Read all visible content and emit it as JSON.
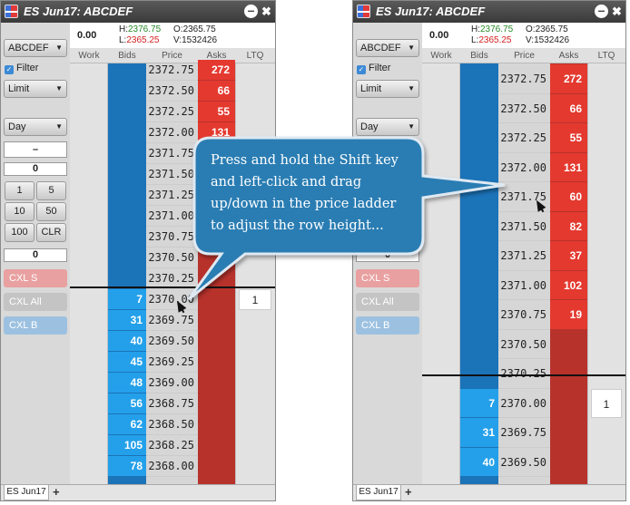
{
  "window_title": "ES Jun17: ABCDEF",
  "minimize_glyph": "–",
  "close_glyph": "✖",
  "quote": {
    "last": "0.00",
    "high_label": "H:",
    "high": "2376.75",
    "low_label": "L:",
    "low": "2365.25",
    "open_label": "O:",
    "open": "2365.75",
    "volume_label": "V:",
    "volume": "1532426"
  },
  "panel": {
    "account": "ABCDEF",
    "filter_label": "Filter",
    "order_type": "Limit",
    "tif": "Day",
    "field_dash": "–",
    "qty_value": "0",
    "qty_buttons": [
      "1",
      "5",
      "10",
      "50",
      "100",
      "CLR"
    ],
    "qty_total": "0",
    "cxl_s": "CXL S",
    "cxl_all": "CXL All",
    "cxl_b": "CXL B"
  },
  "headers": [
    "Work",
    "Bids",
    "Price",
    "Asks",
    "LTQ"
  ],
  "ladder_left": {
    "prices": [
      "2372.75",
      "2372.50",
      "2372.25",
      "2372.00",
      "2371.75",
      "2371.50",
      "2371.25",
      "2371.00",
      "2370.75",
      "2370.50",
      "2370.25",
      "2370.00",
      "2369.75",
      "2369.50",
      "2369.25",
      "2369.00",
      "2368.75",
      "2368.50",
      "2368.25",
      "2368.00"
    ],
    "asks": [
      "272",
      "66",
      "55",
      "131",
      "60",
      "82",
      "37",
      "102",
      "19",
      "",
      "",
      "",
      "",
      "",
      "",
      "",
      "",
      "",
      "",
      ""
    ],
    "bids": [
      "",
      "",
      "",
      "",
      "",
      "",
      "",
      "",
      "",
      "",
      "",
      "7",
      "31",
      "40",
      "45",
      "48",
      "56",
      "62",
      "105",
      "78"
    ],
    "ltq": [
      "",
      "",
      "",
      "",
      "",
      "",
      "",
      "",
      "",
      "",
      "",
      "1",
      "",
      "",
      "",
      "",
      "",
      "",
      "",
      ""
    ]
  },
  "ladder_right": {
    "prices": [
      "2372.75",
      "2372.50",
      "2372.25",
      "2372.00",
      "2371.75",
      "2371.50",
      "2371.25",
      "2371.00",
      "2370.75",
      "2370.50",
      "2370.25",
      "2370.00",
      "2369.75",
      "2369.50"
    ],
    "asks": [
      "272",
      "66",
      "55",
      "131",
      "60",
      "82",
      "37",
      "102",
      "19",
      "",
      "",
      "",
      "",
      ""
    ],
    "bids": [
      "",
      "",
      "",
      "",
      "",
      "",
      "",
      "",
      "",
      "",
      "",
      "7",
      "31",
      "40"
    ],
    "ltq": [
      "",
      "",
      "",
      "",
      "",
      "",
      "",
      "",
      "",
      "",
      "",
      "1",
      "",
      ""
    ]
  },
  "tab_label": "ES Jun17",
  "tab_add": "+",
  "callout_text": "Press and hold the Shift key and left-click and drag up/down in the price ladder to adjust the row height...",
  "colors": {
    "bid_fill": "#24a0ea",
    "bid_column": "#1b73b8",
    "ask_fill": "#e4392f",
    "ask_column": "#b8322c",
    "callout": "#2b7db3"
  },
  "icons": [
    "app-icon",
    "minimize-icon",
    "close-icon",
    "chevron-down-icon",
    "checkbox-checked-icon",
    "mouse-cursor-icon",
    "add-tab-icon"
  ]
}
